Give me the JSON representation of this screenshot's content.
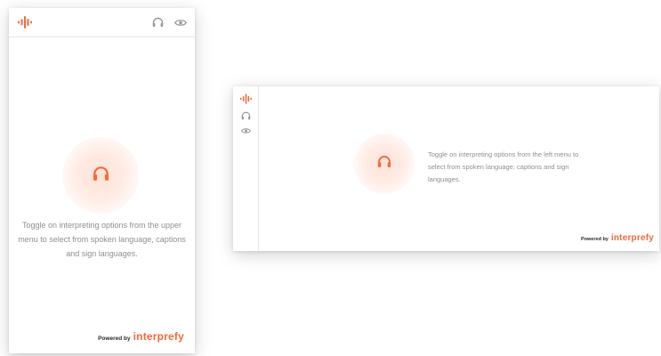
{
  "colors": {
    "accent": "#f16a3c",
    "text_muted": "#8f8f8f",
    "icon_gray": "#9a9a9a",
    "glow": "#ffe1d6"
  },
  "icons": [
    "audio-wave-logo",
    "headphones",
    "eye"
  ],
  "portrait_widget": {
    "message": "Toggle on interpreting options from the upper menu to select from spoken language, captions and sign languages.",
    "powered_by": "Powered by",
    "brand": "interprefy"
  },
  "landscape_widget": {
    "message": "Toggle on interpreting options from the left menu to select from spoken language, captions and sign languages.",
    "powered_by": "Powered by",
    "brand": "interprefy"
  }
}
